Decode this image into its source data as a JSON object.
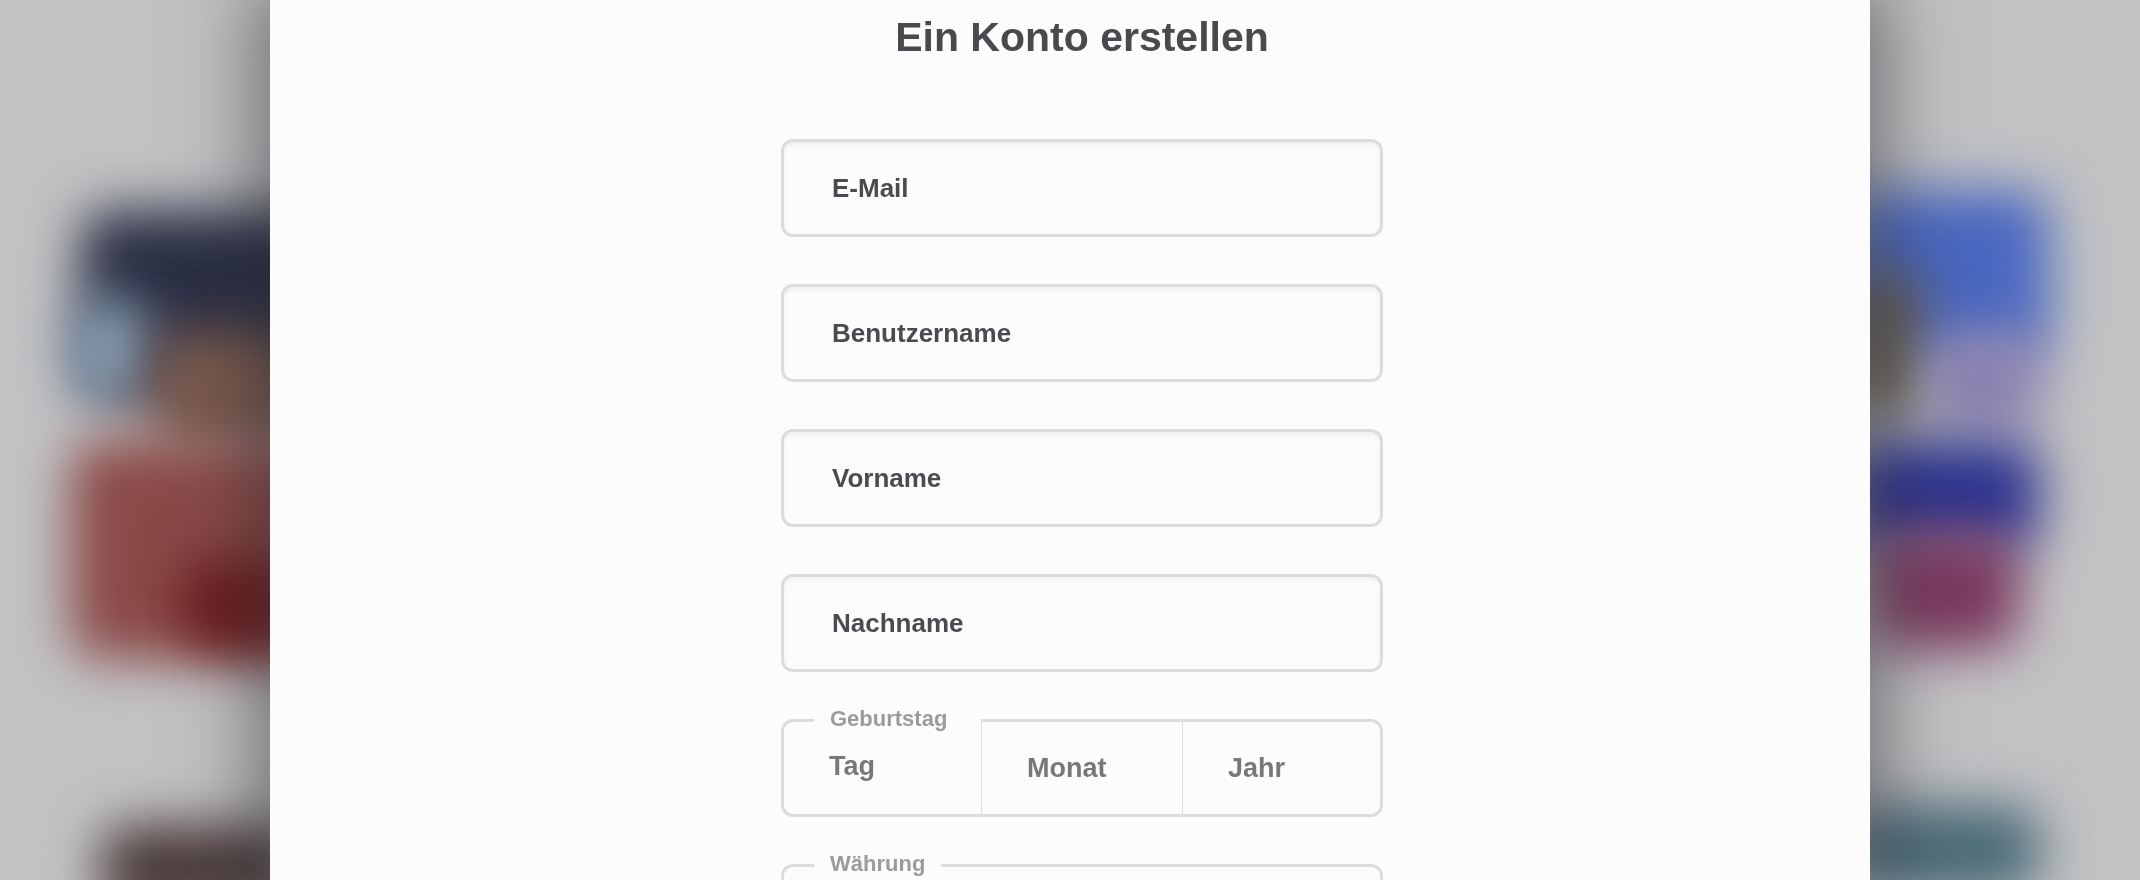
{
  "dialog": {
    "title": "Ein Konto erstellen"
  },
  "fields": [
    {
      "placeholder": "E-Mail"
    },
    {
      "placeholder": "Benutzername"
    },
    {
      "placeholder": "Vorname"
    },
    {
      "placeholder": "Nachname"
    }
  ],
  "birthday": {
    "legend": "Geburtstag",
    "parts": [
      {
        "placeholder": "Tag"
      },
      {
        "placeholder": "Monat"
      },
      {
        "placeholder": "Jahr"
      }
    ]
  },
  "currency": {
    "legend": "Währung"
  }
}
